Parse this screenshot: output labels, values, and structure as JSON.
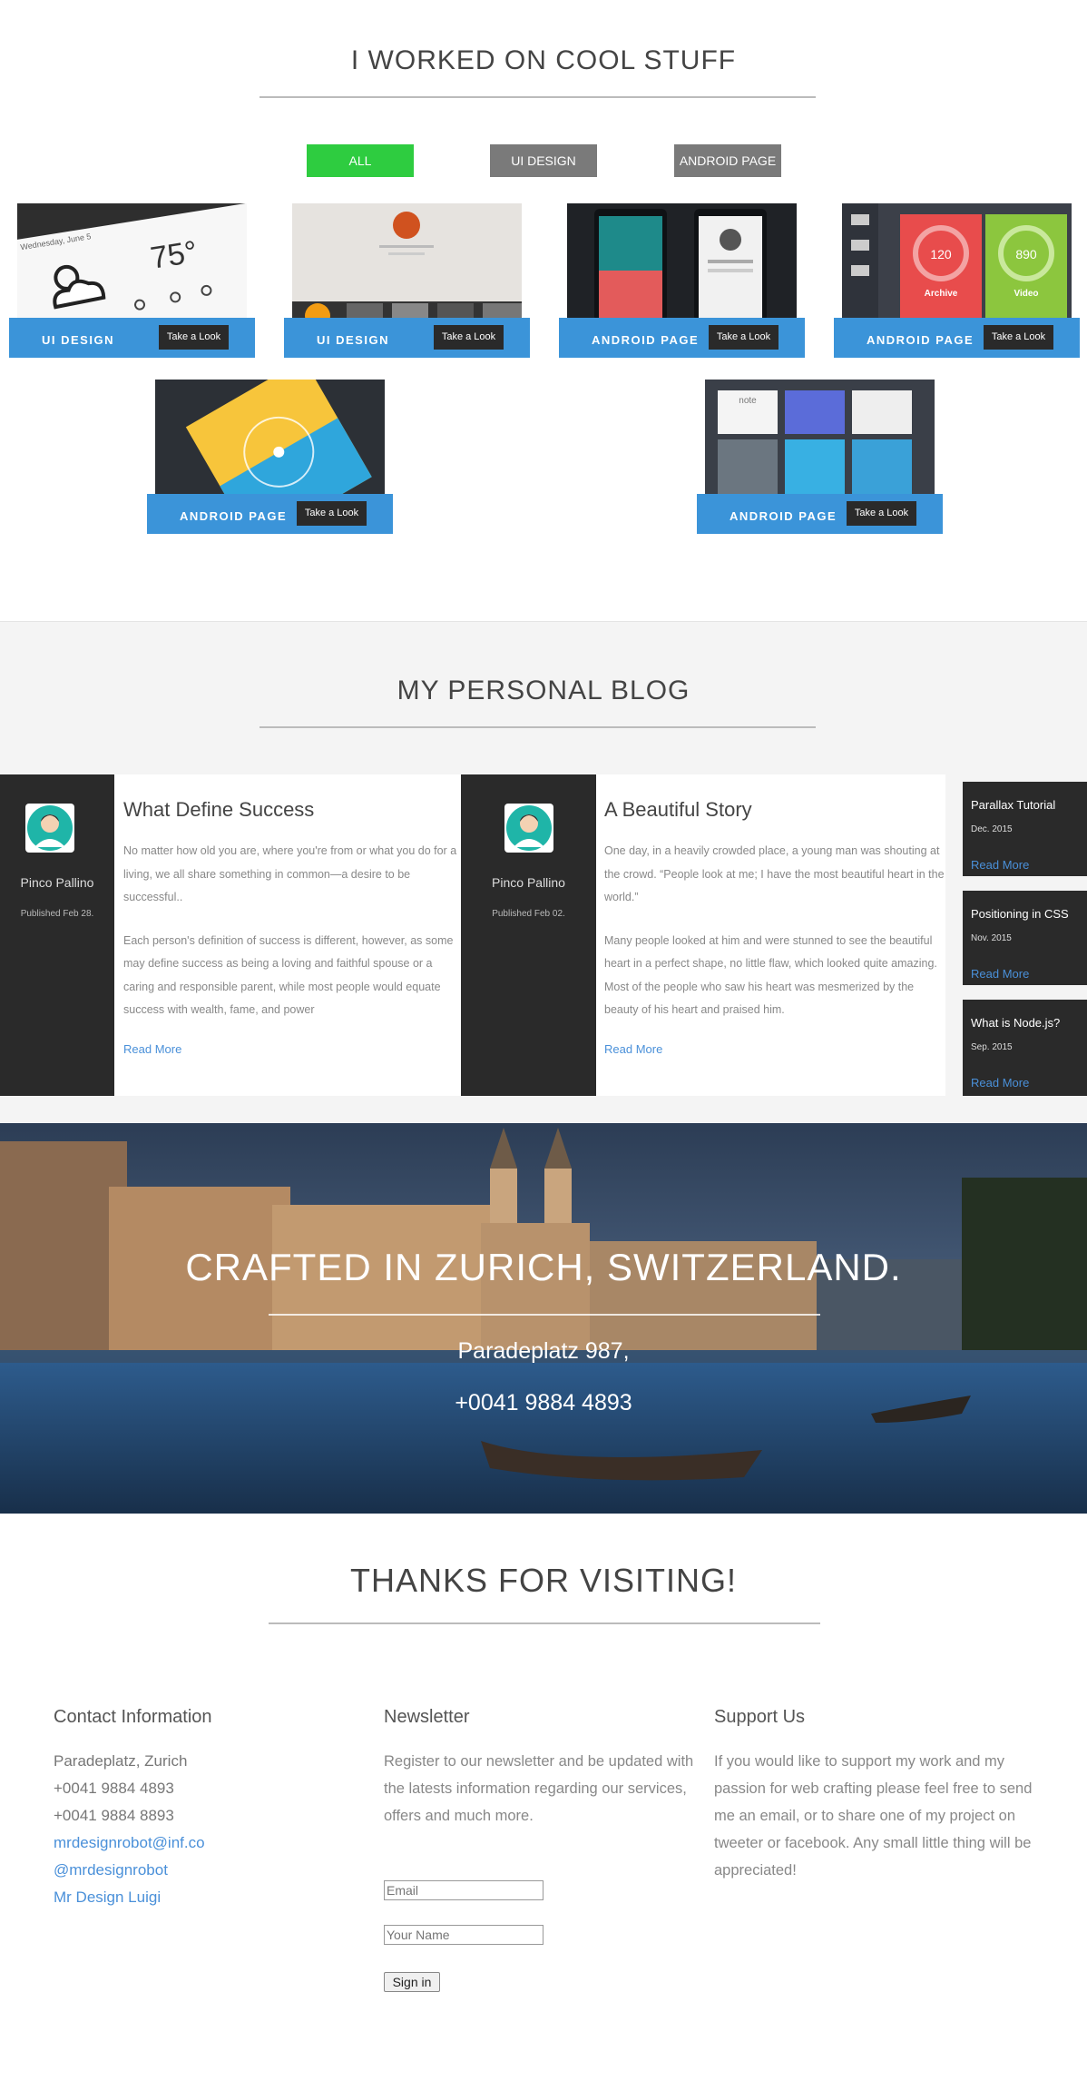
{
  "portfolio": {
    "title": "I WORKED ON COOL STUFF",
    "filters": [
      {
        "label": "ALL",
        "color": "#2ecc40"
      },
      {
        "label": "UI DESIGN",
        "color": "#7a7a7a"
      },
      {
        "label": "ANDROID PAGE",
        "color": "#7a7a7a"
      }
    ],
    "cards": [
      {
        "category": "UI DESIGN",
        "button": "Take a Look",
        "weather_temp": "75°",
        "weather_date": "Wednesday, June 5"
      },
      {
        "category": "UI DESIGN",
        "button": "Take a Look"
      },
      {
        "category": "ANDROID PAGE",
        "button": "Take a Look"
      },
      {
        "category": "ANDROID PAGE",
        "button": "Take a Look",
        "ring1_value": "120",
        "ring1_label": "Archive",
        "ring2_value": "890",
        "ring2_label": "Video"
      },
      {
        "category": "ANDROID PAGE",
        "button": "Take a Look"
      },
      {
        "category": "ANDROID PAGE",
        "button": "Take a Look",
        "note_label": "note"
      }
    ],
    "accent": "#3b94d9"
  },
  "blog": {
    "title": "MY PERSONAL BLOG",
    "posts": [
      {
        "author": "Pinco Pallino",
        "published": "Published Feb 28.",
        "title": "What Define Success",
        "p1": "No matter how old you are, where you're from or what you do for a living, we all share something in common—a desire to be successful..",
        "p2": "Each person's definition of success is different, however, as some may define success as being a loving and faithful spouse or a caring and responsible parent, while most people would equate success with wealth, fame, and power",
        "more": "Read More"
      },
      {
        "author": "Pinco Pallino",
        "published": "Published Feb 02.",
        "title": "A Beautiful Story",
        "p1": "One day, in a heavily crowded place, a young man was shouting at the crowd. “People look at me; I have the most beautiful heart in the world.”",
        "p2": "Many people looked at him and were stunned to see the beautiful heart in a perfect shape, no little flaw, which looked quite amazing. Most of the people who saw his heart was mesmerized by the beauty of his heart and praised him.",
        "more": "Read More"
      }
    ],
    "sidebar": [
      {
        "title": "Parallax Tutorial",
        "date": "Dec. 2015",
        "more": "Read More"
      },
      {
        "title": "Positioning in CSS",
        "date": "Nov. 2015",
        "more": "Read More"
      },
      {
        "title": "What is Node.js?",
        "date": "Sep. 2015",
        "more": "Read More"
      }
    ]
  },
  "hero": {
    "title": "CRAFTED IN ZURICH, SWITZERLAND.",
    "address": "Paradeplatz 987,",
    "phone": "+0041 9884 4893"
  },
  "footer": {
    "title": "THANKS FOR VISITING!",
    "contact": {
      "heading": "Contact Information",
      "lines": [
        "Paradeplatz, Zurich",
        "+0041 9884 4893",
        "+0041 9884 8893"
      ],
      "links": [
        "mrdesignrobot@inf.co",
        "@mrdesignrobot",
        "Mr Design Luigi"
      ]
    },
    "newsletter": {
      "heading": "Newsletter",
      "text": "Register to our newsletter and be updated with the latests information regarding our services, offers and much more.",
      "email_placeholder": "Email",
      "name_placeholder": "Your Name",
      "button": "Sign in"
    },
    "support": {
      "heading": "Support Us",
      "text": "If you would like to support my work and my passion for web crafting please feel free to send me an email, or to share one of my project on tweeter or facebook. Any small little thing will be appreciated!"
    }
  }
}
